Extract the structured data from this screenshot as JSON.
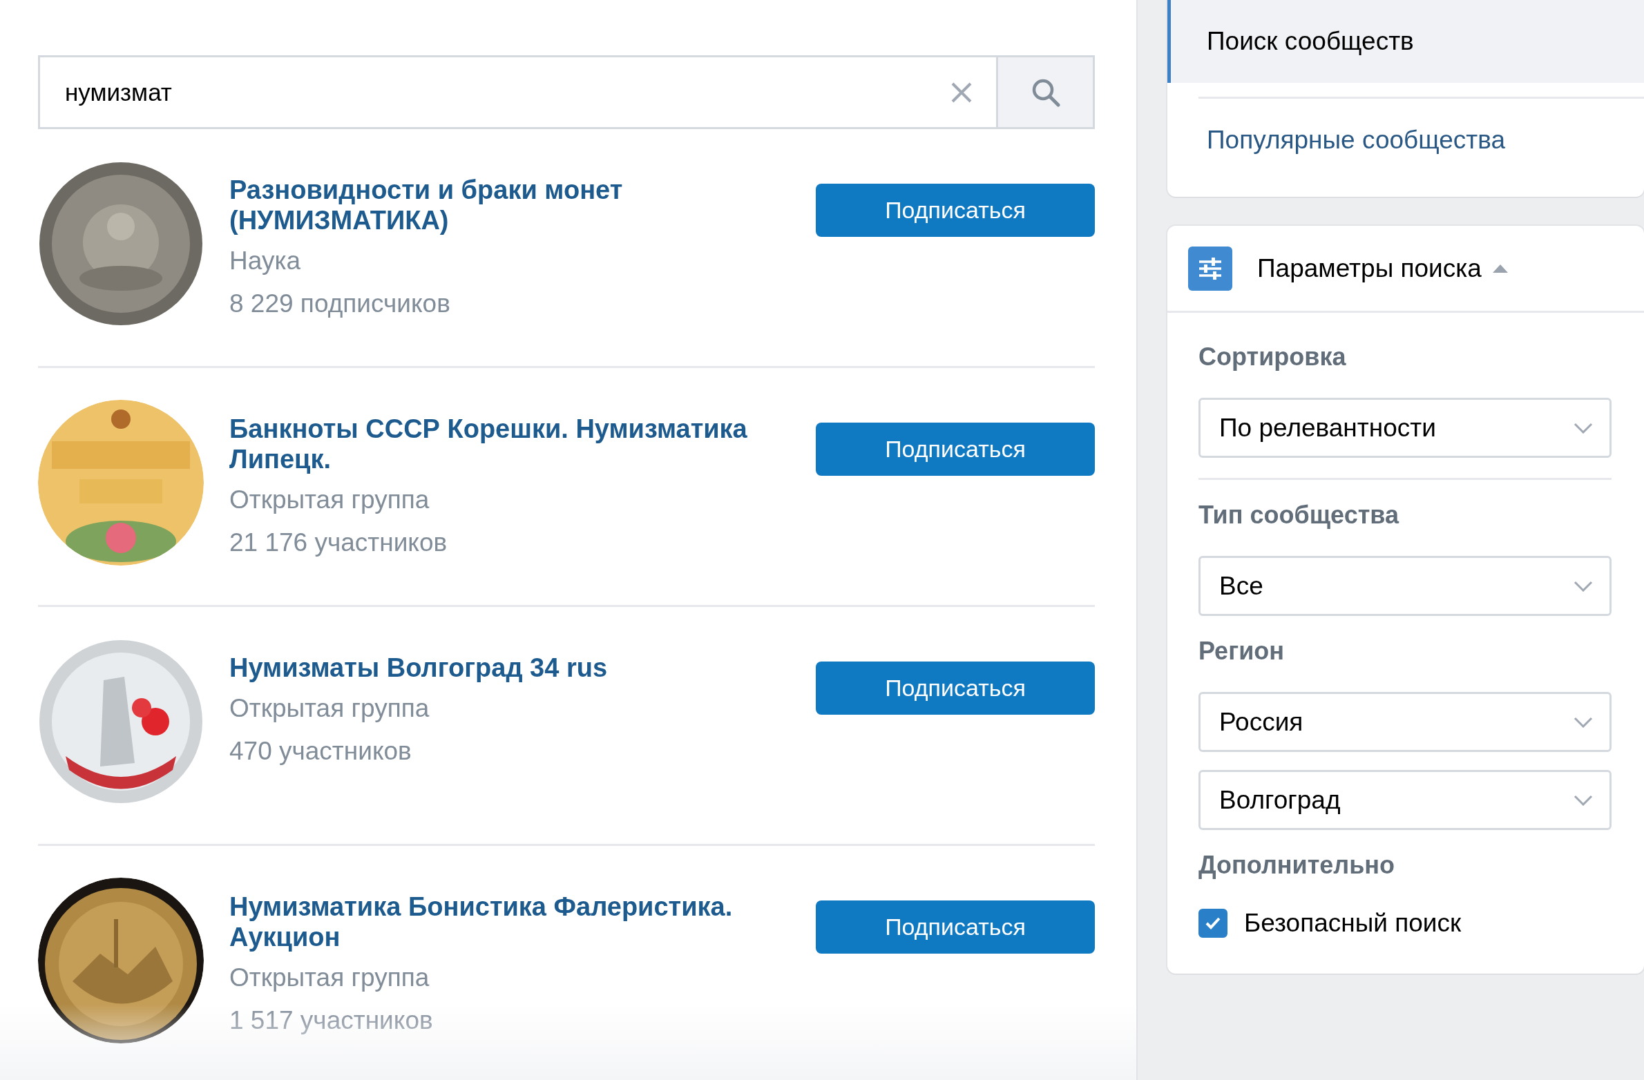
{
  "search": {
    "value": "нумизмат"
  },
  "results": [
    {
      "title": "Разновидности и браки монет (НУМИЗМАТИКА)",
      "category": "Наука",
      "members": "8 229 подписчиков",
      "button": "Подписаться"
    },
    {
      "title": "Банкноты СССР Корешки. Нумизматика Липецк.",
      "category": "Открытая группа",
      "members": "21 176 участников",
      "button": "Подписаться"
    },
    {
      "title": "Нумизматы Волгоград 34 rus",
      "category": "Открытая группа",
      "members": "470 участников",
      "button": "Подписаться"
    },
    {
      "title": "Нумизматика Бонистика Фалеристика. Аукцион",
      "category": "Открытая группа",
      "members": "1 517 участников",
      "button": "Подписаться"
    }
  ],
  "nav": [
    {
      "label": "Поиск сообществ",
      "selected": true
    },
    {
      "label": "Популярные сообщества",
      "selected": false
    }
  ],
  "params": {
    "title": "Параметры поиска",
    "expanded": true,
    "sort": {
      "label": "Сортировка",
      "selects": [
        "По релевантности"
      ]
    },
    "sections": [
      {
        "label": "Тип сообщества",
        "selects": [
          "Все"
        ]
      },
      {
        "label": "Регион",
        "selects": [
          "Россия",
          "Волгоград"
        ]
      }
    ],
    "extra": {
      "label": "Дополнительно",
      "checkbox": {
        "label": "Безопасный поиск",
        "checked": true
      }
    }
  }
}
